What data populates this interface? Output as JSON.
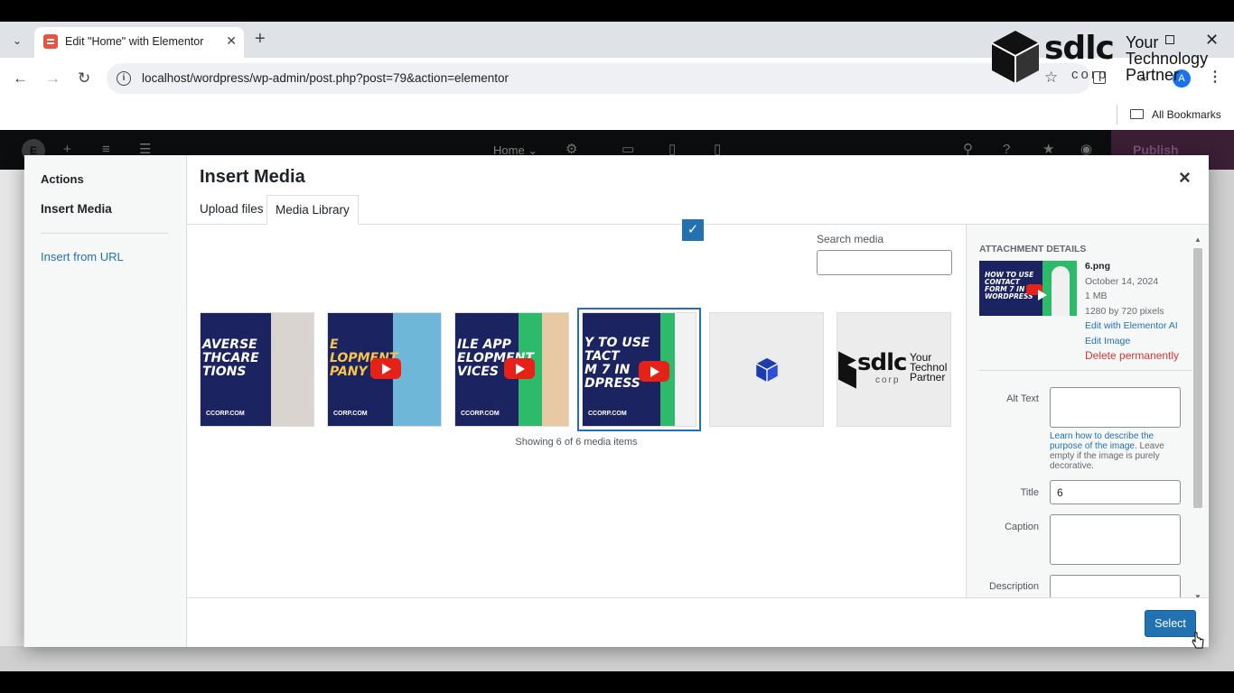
{
  "browser": {
    "tab_title": "Edit \"Home\" with Elementor",
    "url": "localhost/wordpress/wp-admin/post.php?post=79&action=elementor",
    "bookmarks_label": "All Bookmarks",
    "avatar_letter": "A"
  },
  "watermark": {
    "brand": "sdlc",
    "corp": "corp",
    "tagline": [
      "Your",
      "Technology",
      "Partner"
    ]
  },
  "elementor": {
    "page_name": "Home",
    "publish_label": "Publish"
  },
  "modal": {
    "menu_heading": "Actions",
    "menu_active": "Insert Media",
    "menu_link": "Insert from URL",
    "title": "Insert Media",
    "tabs": [
      "Upload files",
      "Media Library"
    ],
    "active_tab": "Media Library",
    "search_label": "Search media",
    "search_value": "",
    "items": [
      {
        "text": "AVERSE\nTHCARE\nTIONS",
        "url": "CCORP.COM",
        "has_play": false,
        "selected": false
      },
      {
        "text": "E\nLOPMENT\nPANY",
        "url": "CORP.COM",
        "has_play": true,
        "selected": false
      },
      {
        "text": "ILE APP\nELOPMENT\nVICES",
        "url": "CCORP.COM",
        "has_play": true,
        "selected": false
      },
      {
        "text": "Y TO USE\nTACT\nM 7 IN\nDPRESS",
        "url": "CCORP.COM",
        "has_play": true,
        "selected": true
      },
      {
        "text": "",
        "url": "",
        "has_play": false,
        "selected": false
      },
      {
        "text": "Your\nTechnol\nPartner",
        "url": "",
        "has_play": false,
        "selected": false
      }
    ],
    "showing_text": "Showing 6 of 6 media items",
    "details": {
      "heading": "ATTACHMENT DETAILS",
      "filename": "6.png",
      "date": "October 14, 2024",
      "size": "1 MB",
      "dimensions": "1280 by 720 pixels",
      "edit_ai": "Edit with Elementor AI",
      "edit_image": "Edit Image",
      "delete": "Delete permanently",
      "thumb_text": "HOW TO USE\nCONTACT\nFORM 7 IN\nWORDPRESS",
      "alt_label": "Alt Text",
      "alt_value": "",
      "help_link": "Learn how to describe the purpose of the image",
      "help_rest": ". Leave empty if the image is purely decorative.",
      "title_label": "Title",
      "title_value": "6",
      "caption_label": "Caption",
      "caption_value": "",
      "description_label": "Description",
      "description_value": ""
    },
    "select_label": "Select"
  },
  "colors": {
    "wp_blue": "#2271b1",
    "delete_red": "#d63638",
    "elementor_bar": "#0c0d0e",
    "thumb_navy": "#1b2460"
  }
}
